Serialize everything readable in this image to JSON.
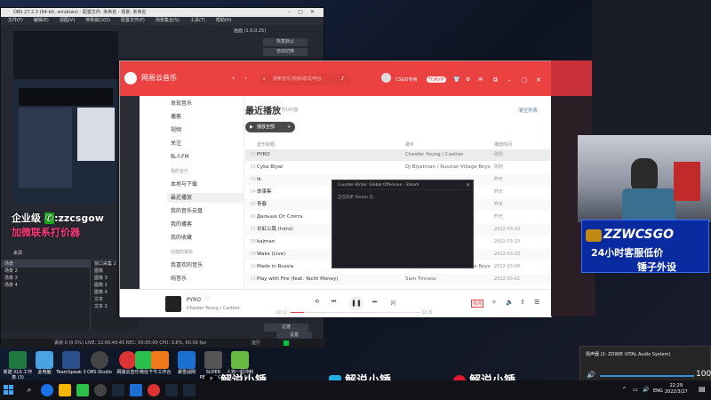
{
  "obs": {
    "title": "OBS 27.2.3 (64-bit, windows) - 配置文件: 未命名 - 场景: 未命名",
    "menu": [
      "文件(F)",
      "编辑(E)",
      "视图(V)",
      "停靠窗口(D)",
      "配置文件(P)",
      "场景集合(S)",
      "工具(T)",
      "帮助(H)"
    ],
    "right_panel_title": "画面 (1.0.0.25)",
    "buttons": [
      "恢复默认",
      "自动切换"
    ],
    "promo_line1": "企业级 ",
    "promo_wechat": "zzcsgow",
    "promo_line2": "加微联系打价器",
    "scenes_header": "来源",
    "scene_items": [
      "场景",
      "场景 2",
      "场景 3",
      "场景 4"
    ],
    "source_items": [
      "窗口采集 2",
      "图像",
      "图像 3",
      "图像 2",
      "图像 4",
      "文本",
      "文本 2"
    ],
    "status": "丢帧 0 (0.0%)   LIVE: 12:00:40:45   REC: 00:00:00   CPU: 3.8%, 60.00 fps",
    "status_right": "运行",
    "transition_btn": "过渡",
    "settings_btn": "设置"
  },
  "netease": {
    "app_name": "网易云音乐",
    "search_placeholder": "搜索音乐/视频/歌词/电台",
    "user_name": "CSGO专用",
    "vip_badge": "开通VIP",
    "sidebar": [
      {
        "label": "发现音乐",
        "type": "nav"
      },
      {
        "label": "播客",
        "type": "nav"
      },
      {
        "label": "视频",
        "type": "nav"
      },
      {
        "label": "关注",
        "type": "nav"
      },
      {
        "label": "私人FM",
        "type": "nav"
      },
      {
        "label": "我的音乐",
        "type": "section"
      },
      {
        "label": "本地与下载",
        "type": "nav"
      },
      {
        "label": "最近播放",
        "type": "selected"
      },
      {
        "label": "我的音乐云盘",
        "type": "nav"
      },
      {
        "label": "我的播客",
        "type": "nav"
      },
      {
        "label": "我的收藏",
        "type": "nav"
      },
      {
        "label": "创建的歌单",
        "type": "section"
      },
      {
        "label": "我喜欢的音乐",
        "type": "nav"
      },
      {
        "label": "纯音乐",
        "type": "nav"
      }
    ],
    "page_title": "最近播放",
    "page_count": "共100首",
    "clear_label": "清空列表",
    "play_all_label": "播放全部",
    "columns": {
      "title": "音乐标题",
      "artist": "歌手",
      "time": "播放时间"
    },
    "rows": [
      {
        "num": "01",
        "title": "PYRO",
        "artist": "Chester Young / Castion",
        "time": "刚刚"
      },
      {
        "num": "02",
        "title": "Cyka Blyat",
        "artist": "DJ Blyatman / Russian Village Boys",
        "time": "刚刚"
      },
      {
        "num": "03",
        "title": "Ik",
        "artist": "",
        "time": "昨天"
      },
      {
        "num": "04",
        "title": "故事集",
        "artist": "",
        "time": "昨天"
      },
      {
        "num": "05",
        "title": "青春",
        "artist": "",
        "time": "昨天"
      },
      {
        "num": "06",
        "title": "Дальше От Слита",
        "artist": "",
        "time": "昨天"
      },
      {
        "num": "07",
        "title": "长虹公路 (Intro)",
        "artist": "",
        "time": "2022-03-23"
      },
      {
        "num": "08",
        "title": "kajman",
        "artist": "",
        "time": "2022-03-23"
      },
      {
        "num": "09",
        "title": "Wake (Live)",
        "artist": "",
        "time": "2022-03-23"
      },
      {
        "num": "10",
        "title": "Made in Russia",
        "artist": "DJ Blyatman / Russian Village Boys",
        "time": "2022-03-08"
      },
      {
        "num": "11",
        "title": "Play with Fire (feat. Yacht Money)",
        "artist": "Sam Tinnesz",
        "time": "2022-03-02"
      }
    ],
    "now_playing": {
      "title": "PYRO",
      "artist": "Chester Young / Castion",
      "elapsed": "00:15",
      "duration": "02:35",
      "progress": 0.1
    },
    "lyric_label": "词",
    "quality_label": "极高"
  },
  "steam_dialog": {
    "title": "Counter-Strike: Global Offensive - Steam",
    "message": "正在同步 Steam 云..."
  },
  "overlay": {
    "zzwc_line1": "ZZWCSGO",
    "zzwc_line2": "24小时客服低价",
    "zzwc_line3": "锤子外设",
    "brands": [
      "解说小锤",
      "解说小锤",
      "解说小锤"
    ]
  },
  "desktop_icons": [
    "新建 XLS 工作表 (3)",
    "此电脑",
    "TeamSpeak 3",
    "OBS Studio",
    "网易云音乐",
    "微信",
    "千牛工作台",
    "暴雪战网",
    "SUPER PEOPLE CBT",
    "人狗一起冲刺 Human Fe..."
  ],
  "audio_flyout": {
    "device": "扬声器 (2- ZOWIE VITAL Audio System)",
    "volume": "100",
    "level": 1.0
  },
  "tray": {
    "lang": "ENG",
    "time": "22:29",
    "date": "2022/3/27"
  },
  "colors": {
    "netease_red": "#ec4141",
    "obs_bg": "#262831",
    "zzwc_blue": "#0a2aa0",
    "promo_pink": "#ff3b7f"
  }
}
